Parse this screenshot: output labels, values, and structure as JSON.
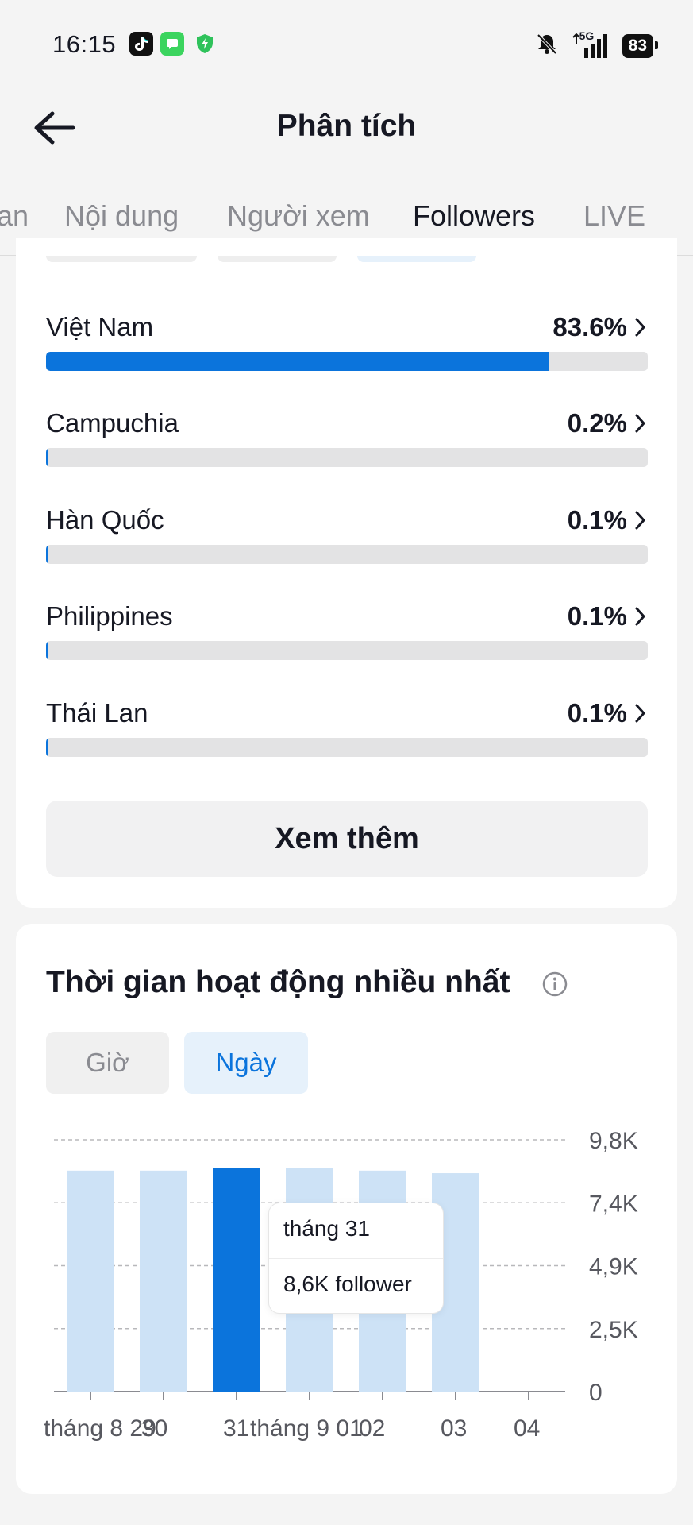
{
  "status_bar": {
    "time": "16:15",
    "network": "5G",
    "battery": "83",
    "icons": [
      "tiktok-icon",
      "messages-icon",
      "shield-icon",
      "bell-muted-icon",
      "signal-icon",
      "battery-icon"
    ]
  },
  "header": {
    "title": "Phân tích",
    "back_icon": "arrow-left-icon"
  },
  "tabs": [
    {
      "label": "an",
      "active": false
    },
    {
      "label": "Nội dung",
      "active": false
    },
    {
      "label": "Người xem",
      "active": false
    },
    {
      "label": "Followers",
      "active": true
    },
    {
      "label": "LIVE",
      "active": false
    }
  ],
  "countries": [
    {
      "name": "Việt Nam",
      "percent_label": "83.6%",
      "value": 83.6
    },
    {
      "name": "Campuchia",
      "percent_label": "0.2%",
      "value": 0.2
    },
    {
      "name": "Hàn Quốc",
      "percent_label": "0.1%",
      "value": 0.1
    },
    {
      "name": "Philippines",
      "percent_label": "0.1%",
      "value": 0.1
    },
    {
      "name": "Thái Lan",
      "percent_label": "0.1%",
      "value": 0.1
    }
  ],
  "see_more_label": "Xem thêm",
  "activity": {
    "title": "Thời gian hoạt động nhiều nhất",
    "segments": {
      "hour": "Giờ",
      "day": "Ngày"
    },
    "selected_segment": "day",
    "tooltip": {
      "date": "tháng 31",
      "value": "8,6K follower"
    }
  },
  "colors": {
    "accent": "#0b74dc",
    "bar_light": "#cde2f6",
    "track": "#e3e3e4"
  },
  "chart_data": {
    "type": "bar",
    "categories": [
      "tháng 8 29",
      "30",
      "31",
      "tháng 9 01",
      "02",
      "03",
      "04"
    ],
    "tick_labels": [
      "tháng 8 29",
      "30",
      "31",
      "tháng 9 01",
      "02",
      "03",
      "04"
    ],
    "values": [
      8.6,
      8.6,
      8.7,
      8.7,
      8.6,
      8.5,
      null
    ],
    "highlight_index": 2,
    "y_ticks": [
      "0",
      "2,5K",
      "4,9K",
      "7,4K",
      "9,8K"
    ],
    "y_tick_values": [
      0,
      2.45,
      4.9,
      7.35,
      9.8
    ],
    "ylim": [
      0,
      9.8
    ],
    "y_axis_side": "right",
    "grid": true,
    "title": "",
    "xlabel": "",
    "ylabel": ""
  }
}
